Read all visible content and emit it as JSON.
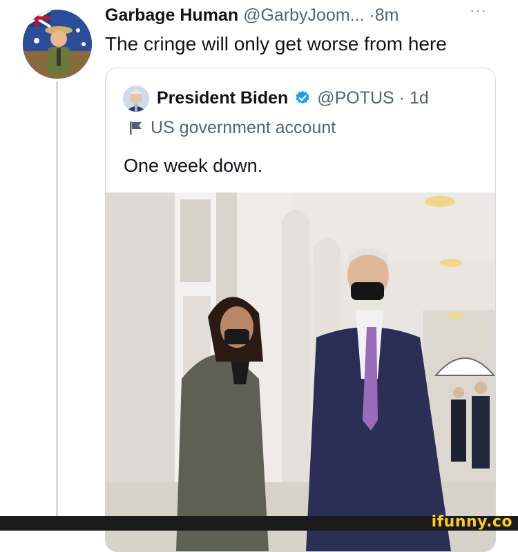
{
  "tweet": {
    "author_name": "Garbage Human",
    "author_handle": "@GarbyJoom...",
    "separator": "·",
    "time": "8m",
    "more": "···",
    "text": "The cringe will only get worse from here"
  },
  "quoted_tweet": {
    "author_name": "President Biden",
    "author_handle": "@POTUS",
    "separator": "·",
    "time": "1d",
    "account_label": "US government account",
    "text": "One week down."
  },
  "colors": {
    "verified_badge": "#1d9bf0",
    "secondary_text": "#536471",
    "watermark": "#ffcc1a"
  },
  "icons": {
    "verified": "verified-badge-icon",
    "flag": "government-flag-icon",
    "more": "more-options-icon"
  },
  "watermark": "ifunny.co"
}
